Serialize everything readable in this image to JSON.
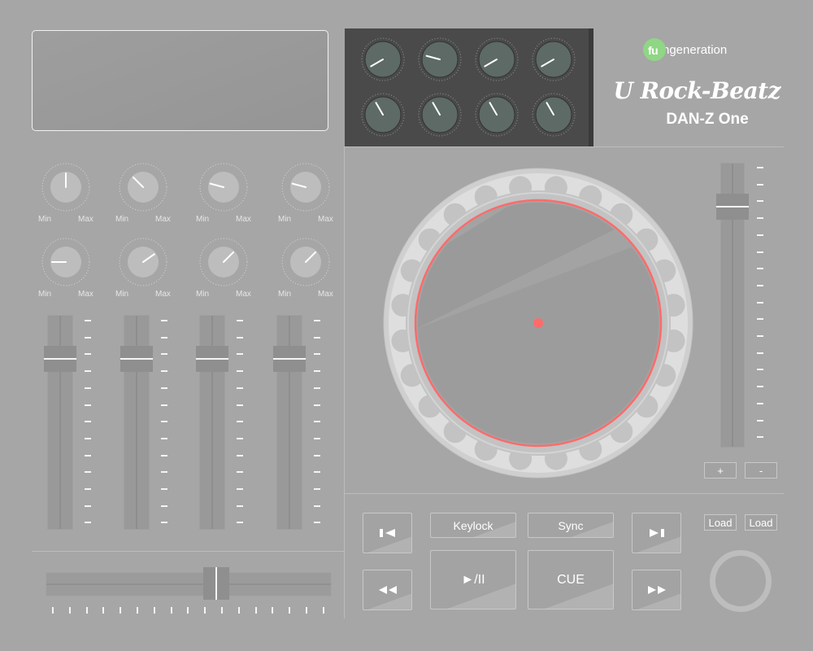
{
  "brand": {
    "logo_prefix": "fu",
    "logo_suffix": "ngeneration",
    "logo_color": "#8fd685",
    "product": "U Rock-Beatz",
    "model": "DAN-Z One"
  },
  "mixer": {
    "knob_min_label": "Min",
    "knob_max_label": "Max",
    "channels": 4
  },
  "transport": {
    "keylock": "Keylock",
    "sync": "Sync",
    "play_pause": "►/II",
    "cue": "CUE"
  },
  "pitch": {
    "plus": "+",
    "minus": "-"
  },
  "load": {
    "left": "Load",
    "right": "Load"
  },
  "colors": {
    "panel_bg": "#a6a6a6",
    "fx_panel": "#4a4a4a",
    "platter_marker": "#ff6b6b",
    "accent_white": "#f4f4f4"
  },
  "icons": {
    "prev": "skip-back-icon",
    "next": "play-skip-icon",
    "rewind": "rewind-icon",
    "fastforward": "fast-forward-icon"
  }
}
